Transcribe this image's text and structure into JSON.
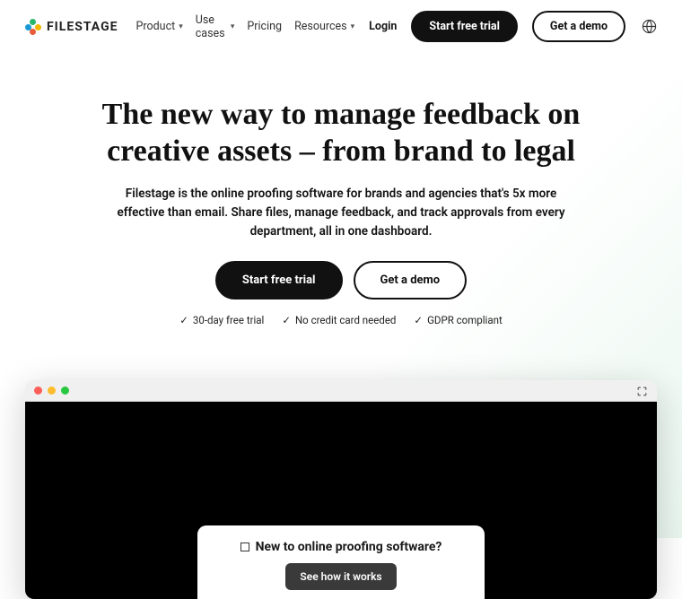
{
  "header": {
    "brand": "FILESTAGE",
    "nav": {
      "product": "Product",
      "usecases": "Use cases",
      "pricing": "Pricing",
      "resources": "Resources"
    },
    "login": "Login",
    "trial": "Start free trial",
    "demo": "Get a demo"
  },
  "hero": {
    "title": "The new way to manage feedback on creative assets – from brand to legal",
    "subtitle": "Filestage is the online proofing software for brands and agencies that's 5x more effective than email. Share files, manage feedback, and track approvals from every department, all in one dashboard.",
    "cta_trial": "Start free trial",
    "cta_demo": "Get a demo",
    "feat1": "30-day free trial",
    "feat2": "No credit card needed",
    "feat3": "GDPR compliant"
  },
  "popup": {
    "title": "New to online proofing software?",
    "button": "See how it works"
  }
}
